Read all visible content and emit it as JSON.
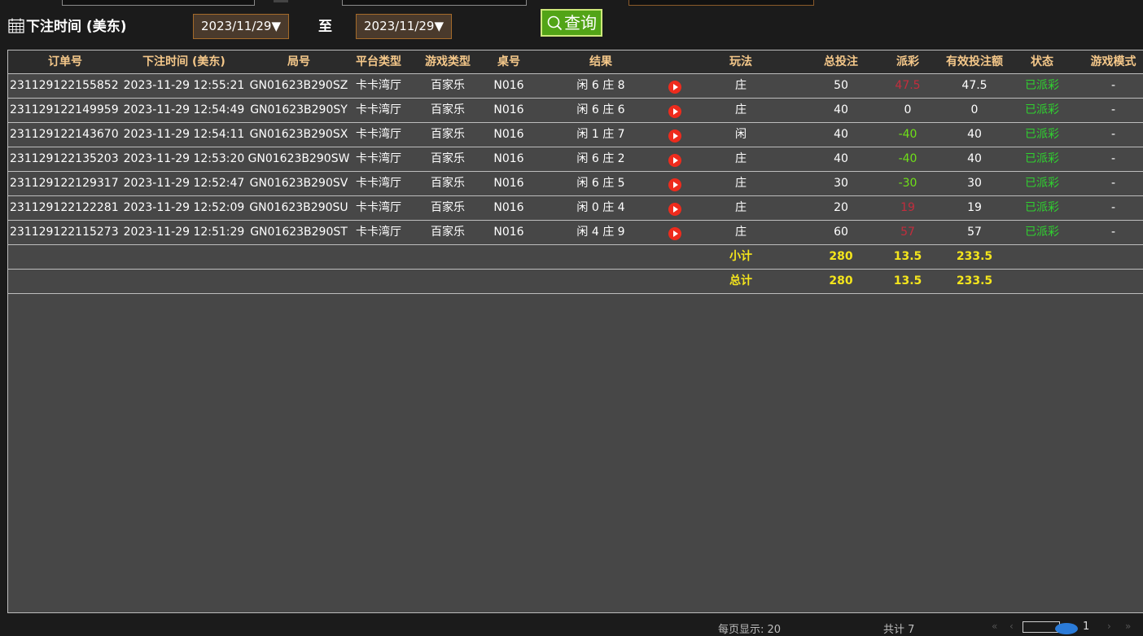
{
  "filter": {
    "label": "下注时间 (美东)",
    "start_date": "2023/11/29▼",
    "to_label": "至",
    "end_date": "2023/11/29▼",
    "query_label": "查询"
  },
  "table": {
    "headers": [
      "订单号",
      "下注时间 (美东)",
      "局号",
      "平台类型",
      "游戏类型",
      "桌号",
      "结果",
      "",
      "玩法",
      "总投注",
      "派彩",
      "有效投注额",
      "状态",
      "游戏模式"
    ],
    "rows": [
      {
        "order": "231129122155852",
        "time": "2023-11-29 12:55:21",
        "round": "GN01623B290SZ",
        "platform": "卡卡湾厅",
        "game": "百家乐",
        "table": "N016",
        "result": "闲 6 庄 8",
        "play": "庄",
        "bet": "50",
        "payout": "47.5",
        "valid": "47.5",
        "status": "已派彩",
        "mode": "-"
      },
      {
        "order": "231129122149959",
        "time": "2023-11-29 12:54:49",
        "round": "GN01623B290SY",
        "platform": "卡卡湾厅",
        "game": "百家乐",
        "table": "N016",
        "result": "闲 6 庄 6",
        "play": "庄",
        "bet": "40",
        "payout": "0",
        "valid": "0",
        "status": "已派彩",
        "mode": "-"
      },
      {
        "order": "231129122143670",
        "time": "2023-11-29 12:54:11",
        "round": "GN01623B290SX",
        "platform": "卡卡湾厅",
        "game": "百家乐",
        "table": "N016",
        "result": "闲 1 庄 7",
        "play": "闲",
        "bet": "40",
        "payout": "-40",
        "valid": "40",
        "status": "已派彩",
        "mode": "-"
      },
      {
        "order": "231129122135203",
        "time": "2023-11-29 12:53:20",
        "round": "GN01623B290SW",
        "platform": "卡卡湾厅",
        "game": "百家乐",
        "table": "N016",
        "result": "闲 6 庄 2",
        "play": "庄",
        "bet": "40",
        "payout": "-40",
        "valid": "40",
        "status": "已派彩",
        "mode": "-"
      },
      {
        "order": "231129122129317",
        "time": "2023-11-29 12:52:47",
        "round": "GN01623B290SV",
        "platform": "卡卡湾厅",
        "game": "百家乐",
        "table": "N016",
        "result": "闲 6 庄 5",
        "play": "庄",
        "bet": "30",
        "payout": "-30",
        "valid": "30",
        "status": "已派彩",
        "mode": "-"
      },
      {
        "order": "231129122122281",
        "time": "2023-11-29 12:52:09",
        "round": "GN01623B290SU",
        "platform": "卡卡湾厅",
        "game": "百家乐",
        "table": "N016",
        "result": "闲 0 庄 4",
        "play": "庄",
        "bet": "20",
        "payout": "19",
        "valid": "19",
        "status": "已派彩",
        "mode": "-"
      },
      {
        "order": "231129122115273",
        "time": "2023-11-29 12:51:29",
        "round": "GN01623B290ST",
        "platform": "卡卡湾厅",
        "game": "百家乐",
        "table": "N016",
        "result": "闲 4 庄 9",
        "play": "庄",
        "bet": "60",
        "payout": "57",
        "valid": "57",
        "status": "已派彩",
        "mode": "-"
      }
    ],
    "subtotal": {
      "label": "小计",
      "bet": "280",
      "payout": "13.5",
      "valid": "233.5"
    },
    "total": {
      "label": "总计",
      "bet": "280",
      "payout": "13.5",
      "valid": "233.5"
    }
  },
  "footer": {
    "per_page": "每页显示: 20",
    "total_count": "共计 7",
    "page_total": "1"
  },
  "colors": {
    "header_text": "#f5c88a",
    "total_text": "#f4e51c",
    "payout_win": "#c32d3d",
    "payout_loss": "#6fe018",
    "status": "#2fd12f",
    "query_button": "#52a417"
  }
}
